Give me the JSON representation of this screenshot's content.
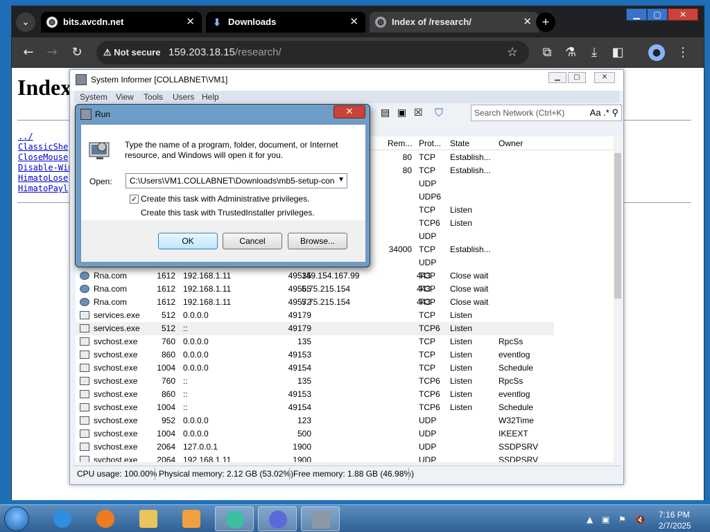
{
  "browser": {
    "tabs": [
      {
        "label": "bits.avcdn.net",
        "icon": "globe-icon"
      },
      {
        "label": "Downloads",
        "icon": "download-icon"
      },
      {
        "label": "Index of /research/",
        "icon": "globe-icon"
      }
    ],
    "security_label": "Not secure",
    "url_host": "159.203.18.15",
    "url_path": "/research/"
  },
  "webpage": {
    "title": "Index",
    "links": [
      "../",
      "ClassicShe",
      "CloseMouse",
      "Disable-Win",
      "HimatoLose",
      "HimatoPayl"
    ]
  },
  "sysinfo": {
    "title": "System Informer [COLLABNET\\VM1]",
    "menu": [
      "System",
      "View",
      "Tools",
      "Users",
      "Help"
    ],
    "search_placeholder": "Search Network (Ctrl+K)",
    "search_icons": "Aa .* ⚲",
    "columns": [
      "Rem...",
      "Prot...",
      "State",
      "Owner"
    ],
    "rows_partial": [
      {
        "rport": "80",
        "proto": "TCP",
        "state": "Establish...",
        "owner": ""
      },
      {
        "rport": "80",
        "proto": "TCP",
        "state": "Establish...",
        "owner": ""
      },
      {
        "rport": "",
        "proto": "UDP",
        "state": "",
        "owner": ""
      },
      {
        "rport": "",
        "proto": "UDP6",
        "state": "",
        "owner": ""
      },
      {
        "rport": "",
        "proto": "TCP",
        "state": "Listen",
        "owner": ""
      },
      {
        "rport": "",
        "proto": "TCP6",
        "state": "Listen",
        "owner": ""
      },
      {
        "rport": "",
        "proto": "UDP",
        "state": "",
        "owner": ""
      },
      {
        "rport": "34000",
        "proto": "TCP",
        "state": "Establish...",
        "owner": ""
      },
      {
        "rport": "",
        "proto": "UDP",
        "state": "",
        "owner": ""
      }
    ],
    "rows": [
      {
        "name": "Rna.com",
        "pid": "1612",
        "laddr": "192.168.1.11",
        "lport": "49535",
        "raddr": "149.154.167.99",
        "rport": "443",
        "proto": "TCP",
        "state": "Close wait",
        "owner": "",
        "icon": "globe"
      },
      {
        "name": "Rna.com",
        "pid": "1612",
        "laddr": "192.168.1.11",
        "lport": "49565",
        "raddr": "5.75.215.154",
        "rport": "443",
        "proto": "TCP",
        "state": "Close wait",
        "owner": "",
        "icon": "globe"
      },
      {
        "name": "Rna.com",
        "pid": "1612",
        "laddr": "192.168.1.11",
        "lport": "49572",
        "raddr": "5.75.215.154",
        "rport": "443",
        "proto": "TCP",
        "state": "Close wait",
        "owner": "",
        "icon": "globe"
      },
      {
        "name": "services.exe",
        "pid": "512",
        "laddr": "0.0.0.0",
        "lport": "49179",
        "raddr": "",
        "rport": "",
        "proto": "TCP",
        "state": "Listen",
        "owner": "",
        "icon": "win"
      },
      {
        "name": "services.exe",
        "pid": "512",
        "laddr": "::",
        "lport": "49179",
        "raddr": "",
        "rport": "",
        "proto": "TCP6",
        "state": "Listen",
        "owner": "",
        "icon": "win",
        "selected": true
      },
      {
        "name": "svchost.exe",
        "pid": "760",
        "laddr": "0.0.0.0",
        "lport": "135",
        "raddr": "",
        "rport": "",
        "proto": "TCP",
        "state": "Listen",
        "owner": "RpcSs",
        "icon": "win"
      },
      {
        "name": "svchost.exe",
        "pid": "860",
        "laddr": "0.0.0.0",
        "lport": "49153",
        "raddr": "",
        "rport": "",
        "proto": "TCP",
        "state": "Listen",
        "owner": "eventlog",
        "icon": "win"
      },
      {
        "name": "svchost.exe",
        "pid": "1004",
        "laddr": "0.0.0.0",
        "lport": "49154",
        "raddr": "",
        "rport": "",
        "proto": "TCP",
        "state": "Listen",
        "owner": "Schedule",
        "icon": "win"
      },
      {
        "name": "svchost.exe",
        "pid": "760",
        "laddr": "::",
        "lport": "135",
        "raddr": "",
        "rport": "",
        "proto": "TCP6",
        "state": "Listen",
        "owner": "RpcSs",
        "icon": "win"
      },
      {
        "name": "svchost.exe",
        "pid": "860",
        "laddr": "::",
        "lport": "49153",
        "raddr": "",
        "rport": "",
        "proto": "TCP6",
        "state": "Listen",
        "owner": "eventlog",
        "icon": "win"
      },
      {
        "name": "svchost.exe",
        "pid": "1004",
        "laddr": "::",
        "lport": "49154",
        "raddr": "",
        "rport": "",
        "proto": "TCP6",
        "state": "Listen",
        "owner": "Schedule",
        "icon": "win"
      },
      {
        "name": "svchost.exe",
        "pid": "952",
        "laddr": "0.0.0.0",
        "lport": "123",
        "raddr": "",
        "rport": "",
        "proto": "UDP",
        "state": "",
        "owner": "W32Time",
        "icon": "win"
      },
      {
        "name": "svchost.exe",
        "pid": "1004",
        "laddr": "0.0.0.0",
        "lport": "500",
        "raddr": "",
        "rport": "",
        "proto": "UDP",
        "state": "",
        "owner": "IKEEXT",
        "icon": "win"
      },
      {
        "name": "svchost.exe",
        "pid": "2064",
        "laddr": "127.0.0.1",
        "lport": "1900",
        "raddr": "",
        "rport": "",
        "proto": "UDP",
        "state": "",
        "owner": "SSDPSRV",
        "icon": "win"
      },
      {
        "name": "svchost.exe",
        "pid": "2064",
        "laddr": "192.168.1.11",
        "lport": "1900",
        "raddr": "",
        "rport": "",
        "proto": "UDP",
        "state": "",
        "owner": "SSDPSRV",
        "icon": "win"
      }
    ],
    "status": {
      "cpu": "CPU usage: 100.00%",
      "physical": "Physical memory: 2.12 GB (53.02%)",
      "free": "Free memory: 1.88 GB (46.98%)"
    }
  },
  "run_dialog": {
    "title": "Run",
    "description": "Type the name of a program, folder, document, or Internet resource, and Windows will open it for you.",
    "open_label": "Open:",
    "open_value": "C:\\Users\\VM1.COLLABNET\\Downloads\\mb5-setup-con",
    "admin_check_label": "Create this task with Administrative privileges.",
    "admin_checked": true,
    "trusted_label": "Create this task with TrustedInstaller privileges.",
    "ok_label": "OK",
    "cancel_label": "Cancel",
    "browse_label": "Browse..."
  },
  "taskbar": {
    "apps": [
      "internet-explorer-icon",
      "firefox-icon",
      "file-explorer-icon",
      "media-player-icon",
      "app-swirl-icon",
      "app-infinity-icon",
      "system-informer-icon"
    ],
    "time": "7:16 PM",
    "date": "2/7/2025"
  },
  "colors": {
    "chrome_dark": "#202124",
    "run_close": "#c9433a",
    "taskbar": "#2f5f94"
  }
}
